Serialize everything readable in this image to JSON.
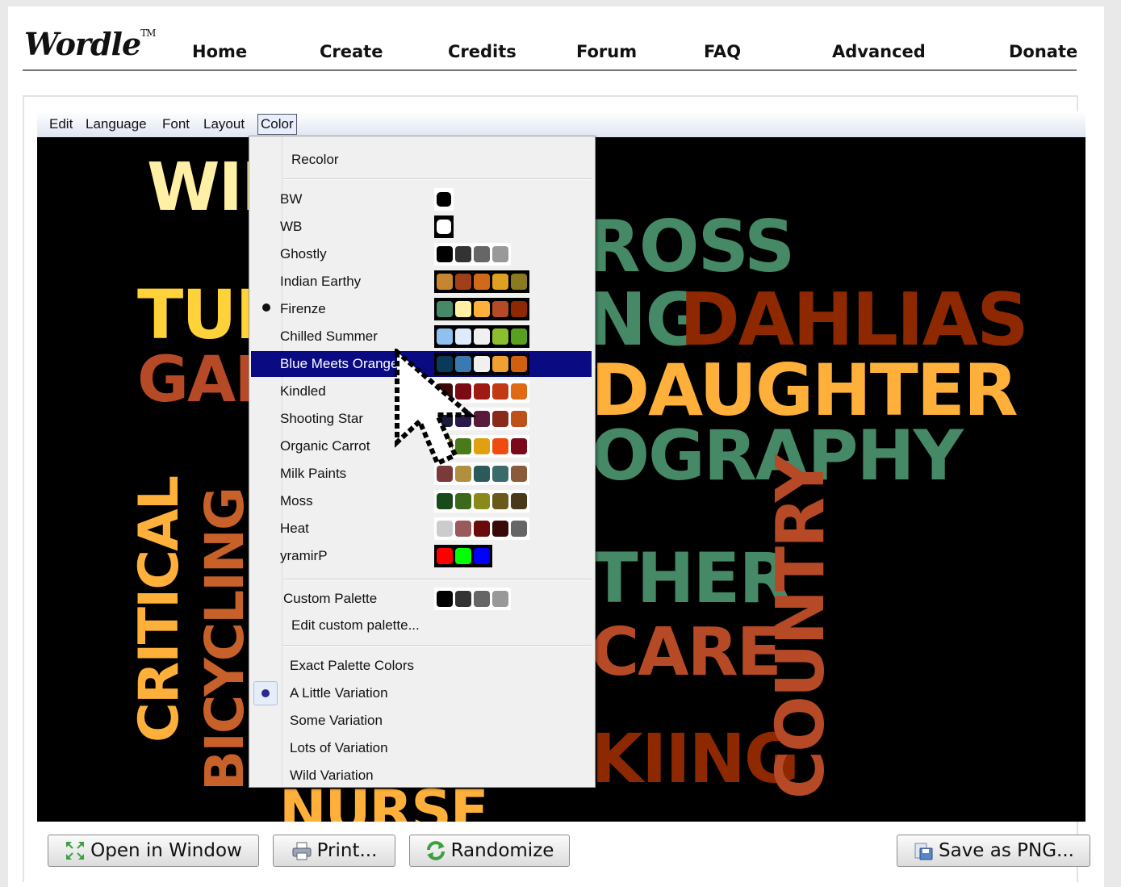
{
  "logo": {
    "text": "Wordle",
    "tm": "TM"
  },
  "nav": [
    "Home",
    "Create",
    "Credits",
    "Forum",
    "FAQ",
    "Advanced",
    "Donate"
  ],
  "menubar": [
    "Edit",
    "Language",
    "Font",
    "Layout",
    "Color"
  ],
  "open_menu": "Color",
  "color_menu": {
    "recolor": "Recolor",
    "palettes": [
      {
        "name": "BW",
        "colors": [
          "#000000"
        ],
        "bg": "#ffffff",
        "selected": false
      },
      {
        "name": "WB",
        "colors": [
          "#ffffff"
        ],
        "bg": "#000000",
        "selected": false
      },
      {
        "name": "Ghostly",
        "colors": [
          "#000000",
          "#333333",
          "#666666",
          "#999999"
        ],
        "bg": "#ffffff",
        "selected": false
      },
      {
        "name": "Indian Earthy",
        "colors": [
          "#c8852f",
          "#a0401a",
          "#d06a1a",
          "#e0a020",
          "#8a7a20"
        ],
        "bg": "#000000",
        "selected": false
      },
      {
        "name": "Firenze",
        "colors": [
          "#468966",
          "#fff0a5",
          "#ffb03b",
          "#b64926",
          "#8e2800"
        ],
        "bg": "#000000",
        "selected": true
      },
      {
        "name": "Chilled Summer",
        "colors": [
          "#8ec0f0",
          "#dcecfa",
          "#f0f0f0",
          "#8ac030",
          "#5aa020"
        ],
        "bg": "#000000",
        "selected": false
      },
      {
        "name": "Blue Meets Orange",
        "colors": [
          "#0a3a5a",
          "#3a7ab0",
          "#f0f0f0",
          "#f0a030",
          "#d06010"
        ],
        "bg": "#000000",
        "selected": false,
        "highlighted": true
      },
      {
        "name": "Kindled",
        "colors": [
          "#3a0a0a",
          "#7a0a14",
          "#a01a14",
          "#c03a14",
          "#e06a14"
        ],
        "bg": "#ffffff",
        "selected": false
      },
      {
        "name": "Shooting Star",
        "colors": [
          "#1a1a3a",
          "#2a1a4a",
          "#5a1a3a",
          "#8a2a1a",
          "#c0501a"
        ],
        "bg": "#ffffff",
        "selected": false
      },
      {
        "name": "Organic Carrot",
        "colors": [
          "#6a6a1a",
          "#4a7a1a",
          "#e0a010",
          "#f04a10",
          "#7a0a1a"
        ],
        "bg": "#ffffff",
        "selected": false
      },
      {
        "name": "Milk Paints",
        "colors": [
          "#7a3a3a",
          "#b09040",
          "#2a5a5a",
          "#3a6a6a",
          "#8a5a3a"
        ],
        "bg": "#ffffff",
        "selected": false
      },
      {
        "name": "Moss",
        "colors": [
          "#1a4a1a",
          "#3a6a1a",
          "#8a8a1a",
          "#6a5a1a",
          "#4a3a1a"
        ],
        "bg": "#ffffff",
        "selected": false
      },
      {
        "name": "Heat",
        "colors": [
          "#cccccc",
          "#9a5a5a",
          "#6a0a0a",
          "#3a0a0a",
          "#666666"
        ],
        "bg": "#ffffff",
        "selected": false
      },
      {
        "name": "yramirP",
        "colors": [
          "#ff0000",
          "#00ff00",
          "#0000ff"
        ],
        "bg": "#000000",
        "selected": false
      }
    ],
    "custom_palette": {
      "name": "Custom Palette",
      "colors": [
        "#000000",
        "#333333",
        "#666666",
        "#999999"
      ],
      "bg": "#ffffff"
    },
    "edit_custom": "Edit custom palette...",
    "variations": [
      {
        "name": "Exact Palette Colors",
        "selected": false
      },
      {
        "name": "A Little Variation",
        "selected": true
      },
      {
        "name": "Some Variation",
        "selected": false
      },
      {
        "name": "Lots of Variation",
        "selected": false
      },
      {
        "name": "Wild Variation",
        "selected": false
      }
    ]
  },
  "cloud_words": [
    {
      "text": "WIF",
      "color": "#fff0a5"
    },
    {
      "text": "TUL",
      "color": "#ffd23a"
    },
    {
      "text": "GAR",
      "color": "#b64926"
    },
    {
      "text": "CRITICAL",
      "color": "#ffb03b"
    },
    {
      "text": "BICYCLING",
      "color": "#c8602a"
    },
    {
      "text": "NURSE",
      "color": "#ffb03b"
    },
    {
      "text": "ROSS",
      "color": "#468966"
    },
    {
      "text": "NG",
      "color": "#468966"
    },
    {
      "text": "DAHLIAS",
      "color": "#8e2800"
    },
    {
      "text": "DAUGHTER",
      "color": "#ffb03b"
    },
    {
      "text": "OGRAPHY",
      "color": "#468966"
    },
    {
      "text": "THER",
      "color": "#468966"
    },
    {
      "text": "CARE",
      "color": "#b64926"
    },
    {
      "text": "KIING",
      "color": "#8e2800"
    },
    {
      "text": "COUNTRY",
      "color": "#b64926"
    }
  ],
  "buttons": {
    "open_window": "Open in Window",
    "print": "Print...",
    "randomize": "Randomize",
    "save_png": "Save as PNG..."
  }
}
